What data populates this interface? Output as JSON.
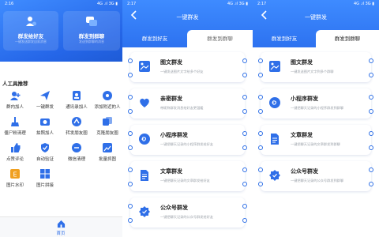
{
  "panel1": {
    "status": {
      "time": "2:16",
      "signal": "4G .ıl 3G ▮"
    },
    "hero": {
      "left": {
        "title": "群发给好友",
        "subtitle": "一键发送群发自家消息"
      },
      "right": {
        "title": "群发到群聊",
        "subtitle": "发送到群聊的消息"
      }
    },
    "tools_title": "人工具推荐",
    "tools": [
      {
        "label": "群内加人",
        "icon": "group-add-icon",
        "color": "#2f6fe8"
      },
      {
        "label": "一键群发",
        "icon": "paper-plane-icon",
        "color": "#2f6fe8"
      },
      {
        "label": "通讯录加人",
        "icon": "contacts-icon",
        "color": "#2f6fe8"
      },
      {
        "label": "添加附近的人",
        "icon": "nearby-icon",
        "color": "#2f6fe8"
      },
      {
        "label": "僵尸粉清理",
        "icon": "broom-icon",
        "color": "#2f6fe8"
      },
      {
        "label": "拍照加人",
        "icon": "camera-icon",
        "color": "#2f6fe8"
      },
      {
        "label": "转发朋友圈",
        "icon": "share-icon",
        "color": "#2f6fe8"
      },
      {
        "label": "克隆朋友圈",
        "icon": "clone-icon",
        "color": "#2f6fe8"
      },
      {
        "label": "点赞评论",
        "icon": "thumb-icon",
        "color": "#2f6fe8"
      },
      {
        "label": "自动验证",
        "icon": "verify-icon",
        "color": "#2f6fe8"
      },
      {
        "label": "微信清理",
        "icon": "clean-icon",
        "color": "#2f6fe8"
      },
      {
        "label": "批量抓图",
        "icon": "grab-icon",
        "color": "#2f6fe8"
      },
      {
        "label": "图片水印",
        "icon": "watermark-icon",
        "color": "#f0a020"
      },
      {
        "label": "图片拼接",
        "icon": "puzzle-icon",
        "color": "#2f6fe8"
      }
    ],
    "nav": {
      "home": "首页"
    }
  },
  "panel2": {
    "status": {
      "time": "2:17",
      "signal": "4G .ıl 3G ▮"
    },
    "title": "一键群发",
    "tabs": [
      "群发到好友",
      "群发到群聊"
    ],
    "features": [
      {
        "title": "图文群发",
        "desc": "一键发送图片文字给多个好友",
        "icon": "image-text-icon"
      },
      {
        "title": "亲密群发",
        "desc": "带昵称群发消息给好友更温暖",
        "icon": "heart-chat-icon"
      },
      {
        "title": "小程序群发",
        "desc": "一键把聊天记录的小程序群发给好友",
        "icon": "mini-program-icon"
      },
      {
        "title": "文章群发",
        "desc": "一键把聊天记录的文章群发给好友",
        "icon": "article-icon"
      },
      {
        "title": "公众号群发",
        "desc": "一键把聊天记录的公众号群发给好友",
        "icon": "official-account-icon"
      }
    ]
  },
  "panel3": {
    "status": {
      "time": "2:17",
      "signal": "4G .ıl 3G ▮"
    },
    "title": "一键群发",
    "tabs": [
      "群发到好友",
      "群发到群聊"
    ],
    "features": [
      {
        "title": "图文群发",
        "desc": "一键发送图片文字到多个群聊",
        "icon": "image-text-icon"
      },
      {
        "title": "小程序群发",
        "desc": "一键把聊天记录的小程序群发到群聊",
        "icon": "mini-program-icon"
      },
      {
        "title": "文章群发",
        "desc": "一键把聊天记录的文章群发到群聊",
        "icon": "article-icon"
      },
      {
        "title": "公众号群发",
        "desc": "一键把聊天记录的公众号群发到群聊",
        "icon": "official-account-icon"
      }
    ]
  },
  "colors": {
    "accent": "#2f6fe8",
    "header": "#3e8bff",
    "background": "#f0f3f8"
  }
}
